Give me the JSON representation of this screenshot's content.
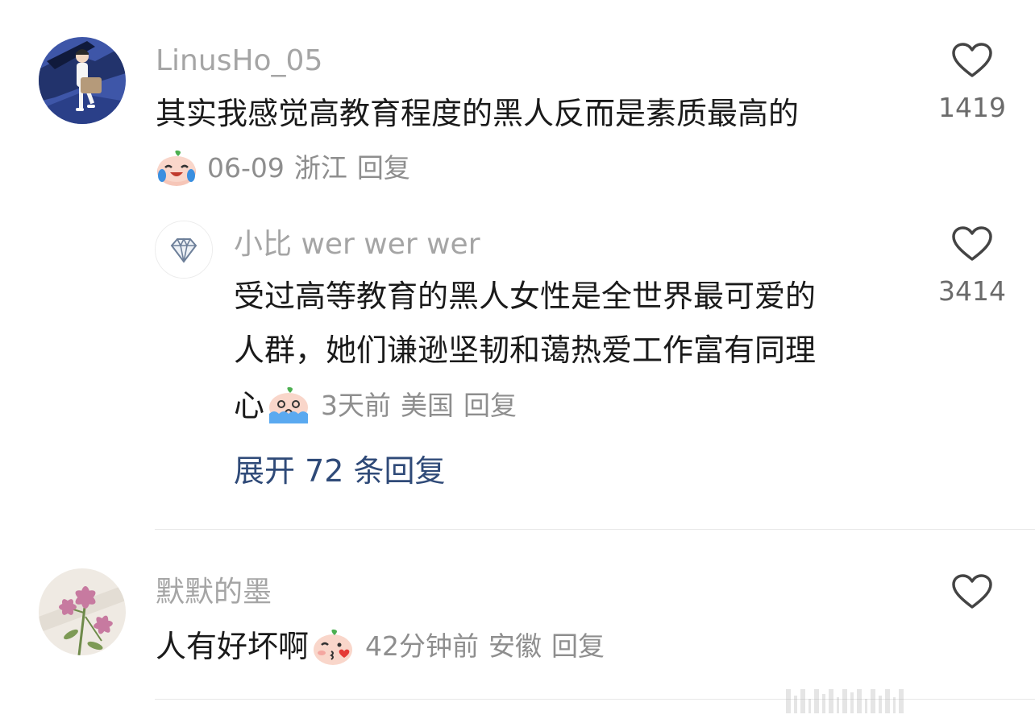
{
  "comments": [
    {
      "username": "LinusHo_05",
      "text": "其实我感觉高教育程度的黑人反而是素质最高的",
      "emoji": "laughing-crying-emoji",
      "date": "06-09",
      "location": "浙江",
      "reply_label": "回复",
      "likes": "1419",
      "avatar": "illustrated-person-avatar",
      "replies": [
        {
          "username": "小比 wer wer wer",
          "text_lines": [
            "受过高等教育的黑人女性是全世界最可爱的",
            "人群，她们谦逊坚韧和蔼热爱工作富有同理",
            "心"
          ],
          "emoji": "crying-emoji",
          "date": "3天前",
          "location": "美国",
          "reply_label": "回复",
          "likes": "3414",
          "avatar": "diamond-avatar"
        }
      ],
      "expand_label": "展开 72 条回复"
    },
    {
      "username": "默默的墨",
      "text": "人有好坏啊",
      "emoji": "kiss-emoji",
      "date": "42分钟前",
      "location": "安徽",
      "reply_label": "回复",
      "avatar": "flower-painting-avatar"
    }
  ],
  "colors": {
    "username": "#a5a5a5",
    "text": "#1a1a1a",
    "meta": "#8e8e8e",
    "expand": "#2f4a78",
    "divider": "#e8e8e8"
  }
}
